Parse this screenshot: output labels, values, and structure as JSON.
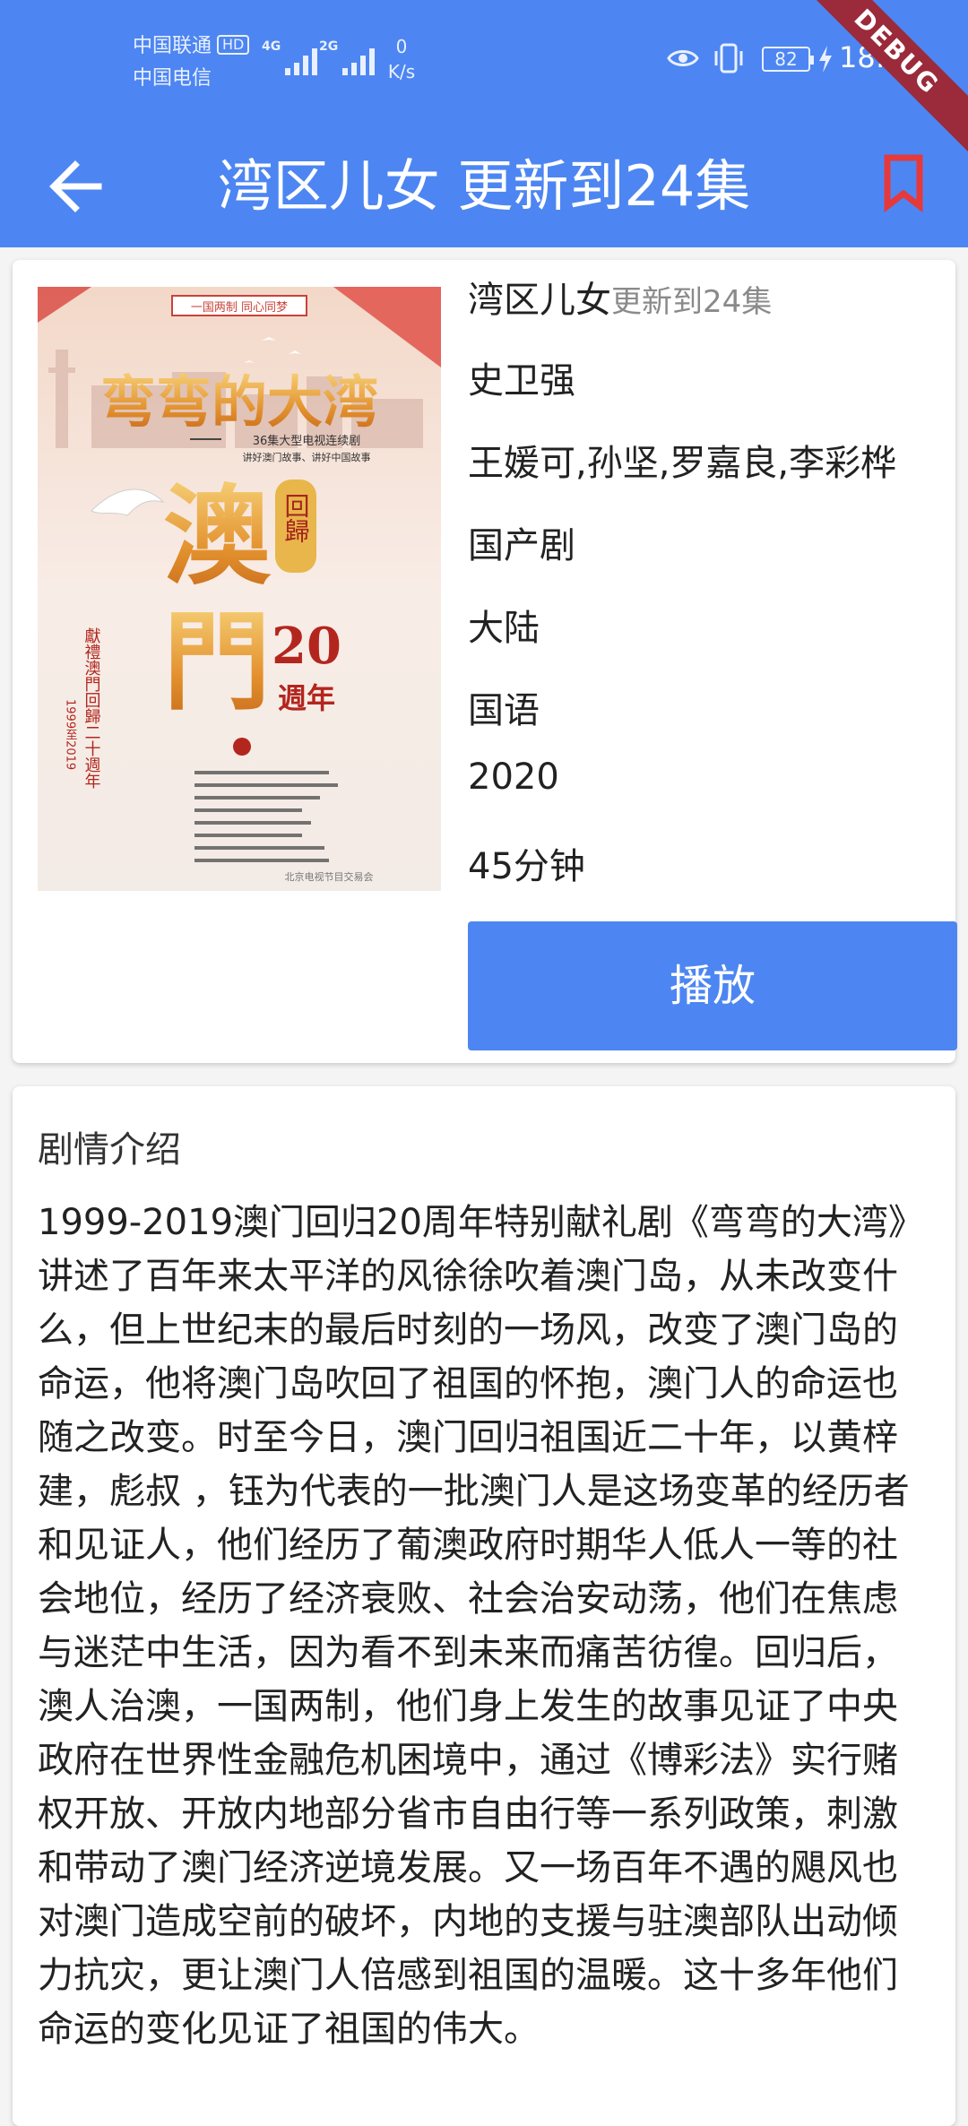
{
  "status_bar": {
    "carrier_1": "中国联通",
    "carrier_1_badge": "HD",
    "carrier_2": "中国电信",
    "signal_1_label": "4G",
    "signal_2_label": "2G",
    "net_speed_value": "0",
    "net_speed_unit": "K/s",
    "battery": "82",
    "time": "18:34",
    "colors": {
      "bar_bg": "#4d86f2",
      "icon": "#e9f0ff"
    }
  },
  "debug_banner": "DEBUG",
  "toolbar": {
    "title": "湾区儿女 更新到24集",
    "back_icon": "arrow-left-icon",
    "bookmark_icon": "bookmark-icon",
    "bookmark_color": "#e5393b"
  },
  "detail": {
    "name": "湾区儿女",
    "update_status": "更新到24集",
    "director": "史卫强",
    "actors": "王媛可,孙坚,罗嘉良,李彩桦",
    "genre": "国产剧",
    "region": "大陆",
    "language": "国语",
    "year": "2020",
    "duration": "45分钟",
    "play_label": "播放",
    "accent": "#4d86f2"
  },
  "poster": {
    "top_banner": "一国两制 同心同梦",
    "main_title": "弯弯的大湾",
    "subtitle_1": "36集大型电视连续剧",
    "subtitle_2": "讲好澳门故事、讲好中国故事",
    "big_1": "澳",
    "big_2": "門",
    "seal": "回歸",
    "anniversary_num": "20",
    "anniversary_text": "週年",
    "vertical_text": "獻禮澳門回歸二十週年",
    "years_text": "1999至2019",
    "watermark": "北京电视节目交易会"
  },
  "synopsis": {
    "heading": "剧情介绍",
    "text": "1999-2019澳门回归20周年特别献礼剧《弯弯的大湾》讲述了百年来太平洋的风徐徐吹着澳门岛，从未改变什么，但上世纪末的最后时刻的一场风，改变了澳门岛的命运，他将澳门岛吹回了祖国的怀抱，澳门人的命运也随之改变。时至今日，澳门回归祖国近二十年，以黄梓建，彪叔 ，钰为代表的一批澳门人是这场变革的经历者和见证人，他们经历了葡澳政府时期华人低人一等的社会地位，经历了经济衰败、社会治安动荡，他们在焦虑与迷茫中生活，因为看不到未来而痛苦彷徨。回归后，澳人治澳，一国两制，他们身上发生的故事见证了中央政府在世界性金融危机困境中，通过《博彩法》实行赌权开放、开放内地部分省市自由行等一系列政策，刺激和带动了澳门经济逆境发展。又一场百年不遇的飓风也对澳门造成空前的破坏，内地的支援与驻澳部队出动倾力抗灾，更让澳门人倍感到祖国的温暖。这十多年他们命运的变化见证了祖国的伟大。"
  }
}
